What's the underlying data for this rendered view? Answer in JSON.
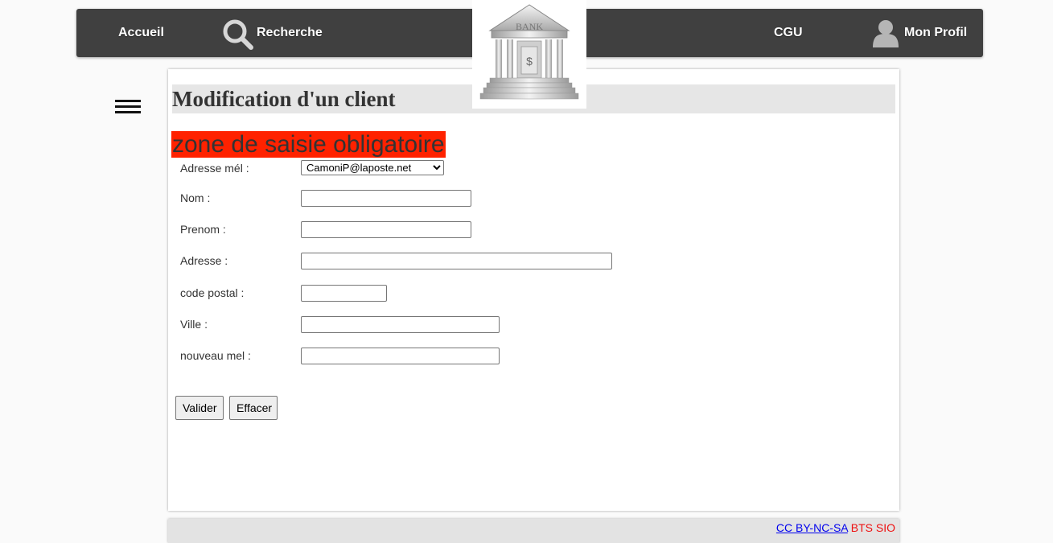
{
  "nav": {
    "home": "Accueil",
    "search": "Recherche",
    "terms": "CGU",
    "profile": "Mon Profil",
    "logo_text": "BANK"
  },
  "page": {
    "title": "Modification d'un client",
    "required_notice": "zone de saisie obligatoire"
  },
  "form": {
    "email_label": "Adresse mél :",
    "email_selected": "CamoniP@laposte.net",
    "nom_label": "Nom :",
    "nom_value": "",
    "prenom_label": "Prenom :",
    "prenom_value": "",
    "adresse_label": "Adresse :",
    "adresse_value": "",
    "cp_label": "code postal :",
    "cp_value": "",
    "ville_label": "Ville :",
    "ville_value": "",
    "new_mail_label": "nouveau mel :",
    "new_mail_value": "",
    "submit_label": "Valider",
    "reset_label": "Effacer"
  },
  "footer": {
    "license": "CC BY-NC-SA",
    "brand": "BTS SIO"
  },
  "colors": {
    "navbar": "#404040",
    "required_banner": "#ff2200",
    "title_band": "#e6e6e6",
    "link": "#0000ee",
    "brand": "#ee1111"
  },
  "icons": {
    "search": "magnifier-icon",
    "profile": "user-silhouette-icon",
    "menu": "hamburger-menu-icon",
    "logo": "bank-building-logo"
  }
}
